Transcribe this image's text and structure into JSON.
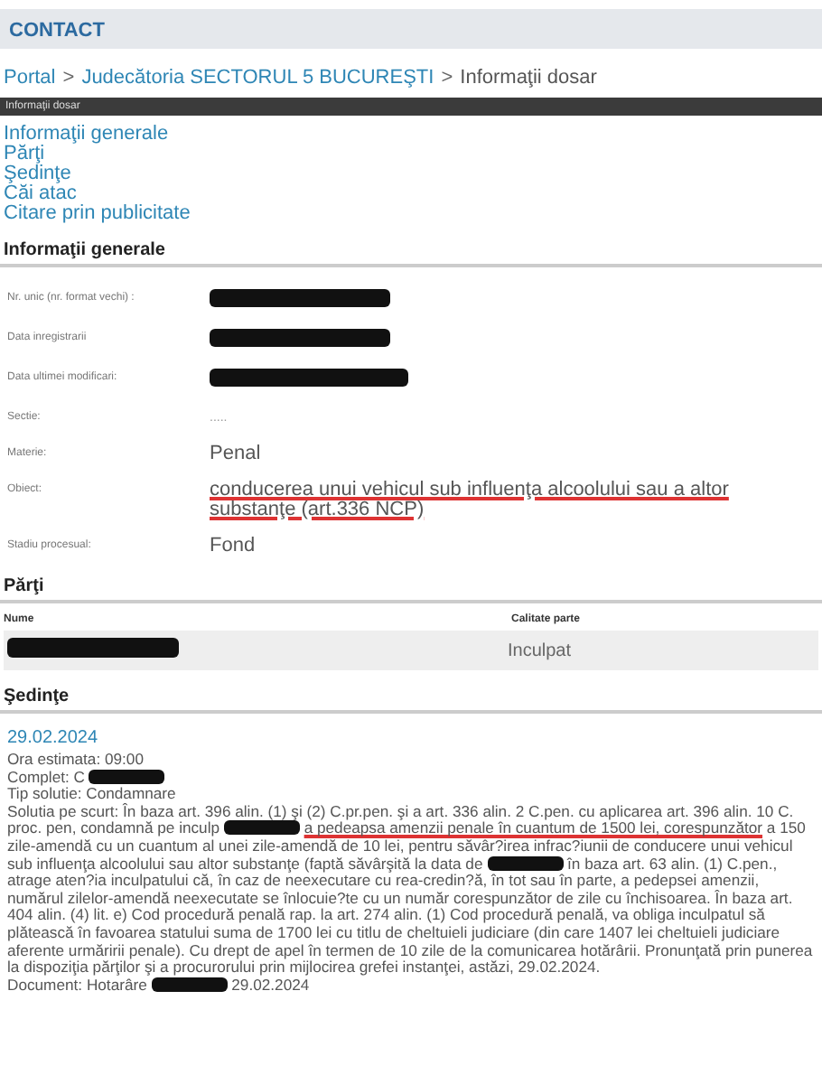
{
  "top_bar": {
    "title": "CONTACT"
  },
  "breadcrumb_separator": ">",
  "breadcrumb": [
    {
      "text": "Portal",
      "link": true
    },
    {
      "text": "Judecătoria SECTORUL 5 BUCUREŞTI",
      "link": true
    },
    {
      "text": "Informaţii dosar",
      "link": false
    }
  ],
  "panel_header": "Informaţii dosar",
  "nav_links": [
    "Informaţii generale",
    "Părţi",
    "Şedinţe",
    "Căi atac",
    "Citare prin publicitate"
  ],
  "general": {
    "heading": "Informaţii generale",
    "fields": [
      {
        "label": "Nr. unic (nr. format vechi) :",
        "kind": "redacted"
      },
      {
        "label": "Data inregistrarii",
        "kind": "redacted"
      },
      {
        "label": "Data ultimei modificari:",
        "kind": "redacted"
      },
      {
        "label": "Sectie:",
        "kind": "muted",
        "value": "....."
      },
      {
        "label": "Materie:",
        "kind": "text",
        "value": "Penal",
        "underlined": false
      },
      {
        "label": "Obiect:",
        "kind": "text",
        "value": "conducerea unui vehicul sub influenţa alcoolului sau a altor substanţe (art.336 NCP)",
        "underlined": true
      },
      {
        "label": "Stadiu procesual:",
        "kind": "text",
        "value": "Fond",
        "underlined": false
      }
    ]
  },
  "parties": {
    "heading": "Părţi",
    "columns": [
      "Nume",
      "Calitate parte"
    ],
    "rows": [
      {
        "role": "Inculpat"
      }
    ]
  },
  "hearings": {
    "heading": "Şedinţe",
    "date": "29.02.2024",
    "lines": [
      {
        "segments": [
          {
            "kind": "text",
            "text": "Ora estimata: 09:00"
          }
        ]
      },
      {
        "segments": [
          {
            "kind": "text",
            "text": "Complet: C"
          },
          {
            "kind": "redacted"
          }
        ]
      },
      {
        "segments": [
          {
            "kind": "text",
            "text": "Tip solutie: Condamnare"
          }
        ]
      },
      {
        "segments": [
          {
            "kind": "text",
            "text": "Solutia pe scurt: În baza art. 396 alin. (1) şi (2) C.pr.pen. şi a art. 336 alin. 2 C.pen. cu aplicarea art. 396 alin. 10 C. proc. pen, condamnă pe inculp"
          },
          {
            "kind": "redacted"
          },
          {
            "kind": "underlined",
            "text": "a pedeapsa amenzii penale în cuantum de 1500 lei, corespunzător"
          },
          {
            "kind": "text",
            "text": "a 150 zile-amendă cu un cuantum al unei zile-amendă de 10 lei, pentru săvâr?irea infrac?iunii de conducere unui vehicul sub influenţa alcoolului sau altor substanţe (faptă săvârşită la data de"
          },
          {
            "kind": "redacted"
          },
          {
            "kind": "text",
            "text": "în baza art. 63 alin. (1) C.pen., atrage aten?ia inculpatului că, în caz de neexecutare cu rea-credin?ă, în tot sau în parte, a pedepsei amenzii, numărul zilelor-amendă neexecutate se înlocuie?te cu un număr corespunzător de zile cu închisoarea. În baza art. 404 alin. (4) lit. e) Cod procedură penală rap. la art. 274 alin. (1) Cod procedură penală, va obliga inculpatul să plătească în favoarea statului suma de 1700 lei cu titlu de cheltuieli judiciare (din care 1407 lei cheltuieli judiciare aferente urmăririi penale). Cu drept de apel în termen de 10 zile de la comunicarea hotărârii. Pronunţată prin punerea la dispoziţia părţilor şi a procurorului prin mijlocirea grefei instanţei, astăzi, 29.02.2024."
          }
        ]
      },
      {
        "segments": [
          {
            "kind": "text",
            "text": "Document: Hotarâre"
          },
          {
            "kind": "redacted"
          },
          {
            "kind": "text",
            "text": "29.02.2024"
          }
        ]
      }
    ]
  }
}
